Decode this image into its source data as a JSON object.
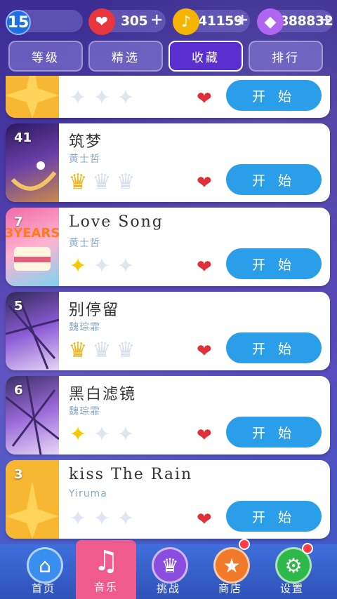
{
  "header": {
    "level": "15",
    "hearts": "305",
    "notes": "41159",
    "gems": "888832",
    "plus": "+"
  },
  "tabs": [
    {
      "label": "等级"
    },
    {
      "label": "精选"
    },
    {
      "label": "收藏",
      "active": true
    },
    {
      "label": "排行"
    }
  ],
  "songs": [
    {
      "num": "",
      "title": "",
      "artist": "",
      "rating": "stars",
      "filled": 0,
      "start": "开 始"
    },
    {
      "num": "41",
      "title": "筑梦",
      "artist": "黄士哲",
      "rating": "crowns",
      "filled": 1,
      "start": "开 始"
    },
    {
      "num": "7",
      "title": "Love Song",
      "artist": "黄士哲",
      "rating": "stars",
      "filled": 1,
      "start": "开 始"
    },
    {
      "num": "5",
      "title": "别停留",
      "artist": "魏琮霏",
      "rating": "crowns",
      "filled": 1,
      "start": "开 始"
    },
    {
      "num": "6",
      "title": "黑白滤镜",
      "artist": "魏琮霏",
      "rating": "stars",
      "filled": 1,
      "start": "开 始"
    },
    {
      "num": "3",
      "title": "kiss The Rain",
      "artist": "Yiruma",
      "rating": "stars",
      "filled": 0,
      "start": "开 始"
    }
  ],
  "nav": [
    {
      "label": "首页",
      "icon": "home-icon"
    },
    {
      "label": "音乐",
      "icon": "music-note-icon",
      "active": true
    },
    {
      "label": "挑战",
      "icon": "trophy-icon"
    },
    {
      "label": "商店",
      "icon": "cart-icon",
      "badge": true
    },
    {
      "label": "设置",
      "icon": "gear-icon",
      "badge": true
    }
  ]
}
